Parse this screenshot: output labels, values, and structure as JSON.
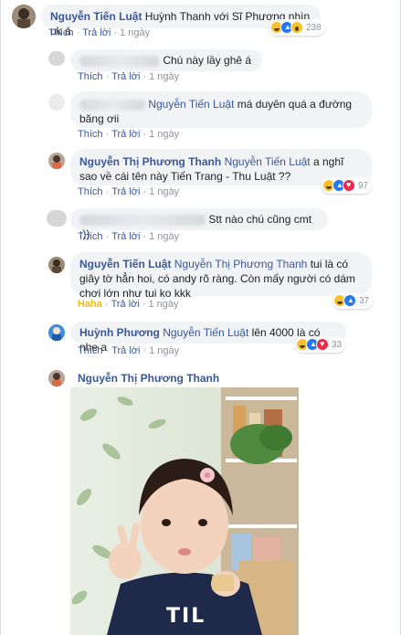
{
  "labels": {
    "like": "Thích",
    "reply": "Trả lời",
    "haha": "Haha",
    "separator": "·"
  },
  "colors": {
    "link": "#385898",
    "bubble": "#f2f3f5",
    "muted": "#90949c",
    "haha": "#f0ba15"
  },
  "comments": [
    {
      "author": "Nguyễn Tiến Luật",
      "text": "Huỳnh Thanh với Sĩ Phương nhìn ok á",
      "time": "1 ngày",
      "reactions": {
        "icons": [
          "haha-icon",
          "like-icon",
          "wow-icon"
        ],
        "count": "238"
      }
    },
    {
      "author_hidden": true,
      "text": "Chú này lầy ghê á",
      "time": "1 ngày"
    },
    {
      "author_hidden": true,
      "tag": "Nguyễn Tiến Luật",
      "text": "má duyên quá a đường băng ơii",
      "time": "1 ngày"
    },
    {
      "author": "Nguyễn Thị Phương Thanh",
      "tag": "Nguyễn Tiến Luật",
      "text": "a nghĩ sao về cái tên này Tiến Trang - Thu Luật ??",
      "time": "1 ngày",
      "reactions": {
        "icons": [
          "haha-icon",
          "like-icon",
          "love-icon"
        ],
        "count": "97"
      }
    },
    {
      "author_hidden": true,
      "text": "Stt nào chú cũng cmt :))",
      "time": "1 ngày"
    },
    {
      "author": "Nguyễn Tiến Luật",
      "tag": "Nguyễn Thị Phương Thanh",
      "text": "tui là có giây tờ hẳn hoi, có andy rõ ràng. Còn mấy người có dám chơi lớn như tui ko kkk",
      "time": "1 ngày",
      "reacted": "Haha",
      "reactions": {
        "icons": [
          "haha-icon",
          "like-icon"
        ],
        "count": "37"
      }
    },
    {
      "author": "Huỳnh Phương",
      "tag": "Nguyễn Tiến Luật",
      "text": "lên 4000 là có nhe a",
      "time": "1 ngày",
      "reactions": {
        "icons": [
          "haha-icon",
          "like-icon",
          "love-icon"
        ],
        "count": "33"
      }
    },
    {
      "author": "Nguyễn Thị Phương Thanh",
      "photo": "photo-of-toddler-waving"
    }
  ],
  "photo": {
    "shirt_text": "TIL"
  }
}
